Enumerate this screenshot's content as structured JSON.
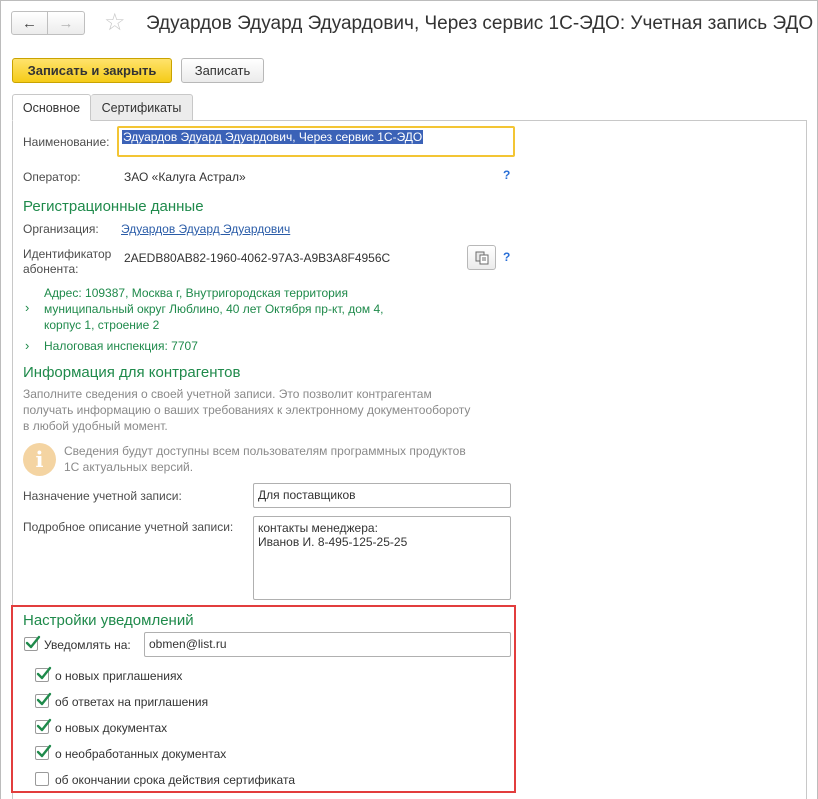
{
  "window": {
    "title": "Эдуардов Эдуард Эдуардович, Через сервис 1С-ЭДО: Учетная запись ЭДО"
  },
  "nav": {
    "back_glyph": "←",
    "forward_glyph": "→",
    "favorite_glyph": "☆"
  },
  "toolbar": {
    "save_close_label": "Записать и закрыть",
    "save_label": "Записать"
  },
  "tabs": [
    {
      "label": "Основное",
      "active": true
    },
    {
      "label": "Сертификаты",
      "active": false
    }
  ],
  "form": {
    "name_label": "Наименование:",
    "name_value": "Эдуардов Эдуард Эдуардович, Через сервис 1С-ЭДО",
    "operator_label": "Оператор:",
    "operator_value": "ЗАО «Калуга Астрал»",
    "help_glyph": "?"
  },
  "registration": {
    "heading": "Регистрационные данные",
    "org_label": "Организация:",
    "org_value": "Эдуардов Эдуард Эдуардович",
    "subscriber_label_1": "Идентификатор",
    "subscriber_label_2": "абонента:",
    "subscriber_id": "2AEDB80AB82-1960-4062-97A3-A9B3A8F4956C",
    "address_line_1": "Адрес: 109387, Москва г, Внутригородская территория",
    "address_line_2": "муниципальный округ Люблино, 40 лет Октября пр-кт, дом 4,",
    "address_line_3": "корпус 1, строение 2",
    "tax_office": "Налоговая инспекция: 7707",
    "chevron_glyph": "›"
  },
  "counterparty_info": {
    "heading": "Информация для контрагентов",
    "description_1": "Заполните сведения о своей учетной записи. Это позволит контрагентам",
    "description_2": "получать информацию о ваших требованиях к электронному документообороту",
    "description_3": "в любой удобный момент.",
    "notice_icon_glyph": "i",
    "notice_1": "Сведения будут доступны всем пользователям программных продуктов",
    "notice_2": "1С актуальных версий.",
    "purpose_label": "Назначение учетной записи:",
    "purpose_value": "Для поставщиков",
    "description_label": "Подробное описание учетной записи:",
    "description_value_1": "контакты менеджера:",
    "description_value_2": "Иванов И. 8-495-125-25-25"
  },
  "notifications": {
    "heading": "Настройки уведомлений",
    "notify_label": "Уведомлять на:",
    "notify_checked": true,
    "email": "obmen@list.ru",
    "options": [
      {
        "label": "о новых приглашениях",
        "checked": true
      },
      {
        "label": "об ответах на приглашения",
        "checked": true
      },
      {
        "label": "о новых документах",
        "checked": true
      },
      {
        "label": "о необработанных документах",
        "checked": true
      },
      {
        "label": "об окончании срока действия сертификата",
        "checked": false
      }
    ]
  },
  "colors": {
    "accent_green": "#1f8a4b",
    "link_blue": "#2a5ca8",
    "primary_button": "#f5cc18",
    "highlight_frame": "#e23d3d",
    "focus_frame": "#f3c534"
  }
}
